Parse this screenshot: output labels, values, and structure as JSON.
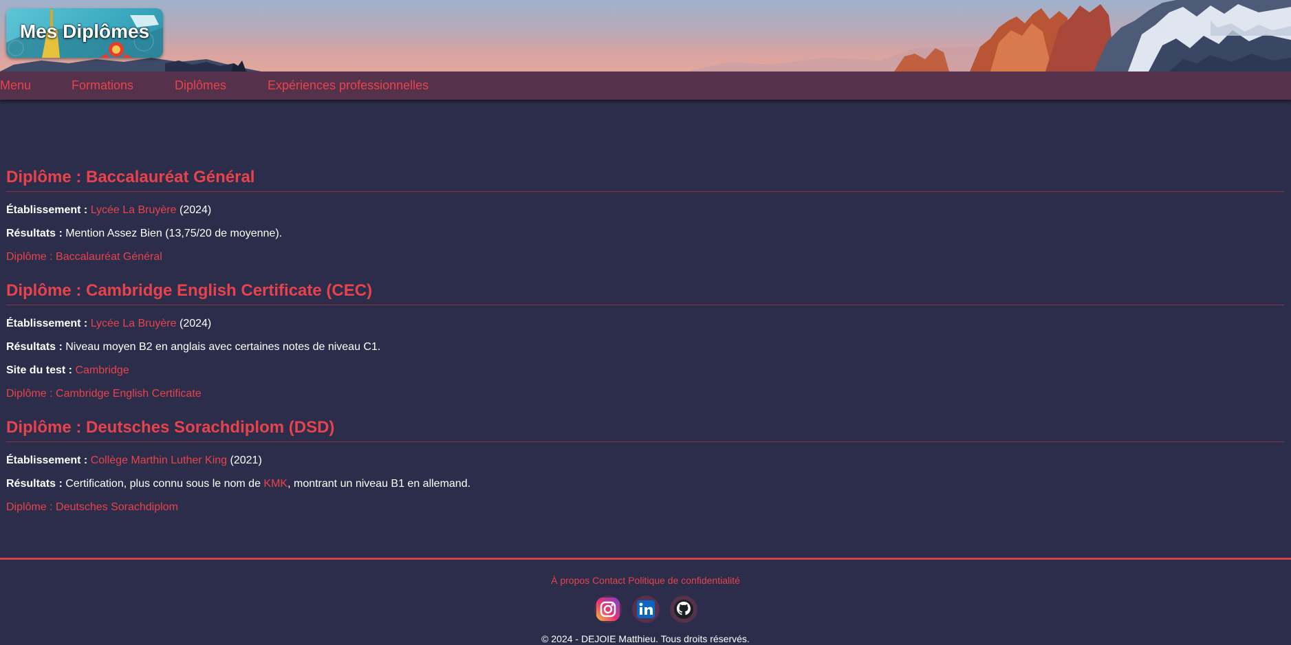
{
  "header": {
    "logo_title": "Mes Diplômes"
  },
  "nav": {
    "items": [
      {
        "label": "Menu"
      },
      {
        "label": "Formations"
      },
      {
        "label": "Diplômes"
      },
      {
        "label": "Expériences professionnelles"
      }
    ]
  },
  "labels": {
    "etablissement": "Établissement :",
    "resultats": "Résultats :",
    "site_test": "Site du test :"
  },
  "diplomas": [
    {
      "title": "Diplôme : Baccalauréat Général",
      "school": "Lycée La Bruyère",
      "year": "(2024)",
      "results": "Mention Assez Bien (13,75/20 de moyenne).",
      "diploma_link": "Diplôme : Baccalauréat Général"
    },
    {
      "title": "Diplôme : Cambridge English Certificate (CEC)",
      "school": "Lycée La Bruyère",
      "year": "(2024)",
      "results": "Niveau moyen B2 en anglais avec certaines notes de niveau C1.",
      "test_site": "Cambridge",
      "diploma_link": "Diplôme : Cambridge English Certificate"
    },
    {
      "title": "Diplôme : Deutsches Sorachdiplom (DSD)",
      "school": "Collège Marthin Luther King",
      "year": "(2021)",
      "results_before": "Certification, plus connu sous le nom de",
      "results_link": "KMK",
      "results_after": ", montrant un niveau B1 en allemand.",
      "diploma_link": "Diplôme : Deutsches Sorachdiplom"
    }
  ],
  "footer": {
    "links": [
      {
        "label": "À propos"
      },
      {
        "label": "Contact"
      },
      {
        "label": "Politique de confidentialité"
      }
    ],
    "copyright": "© 2024 - DEJOIE Matthieu. Tous droits réservés."
  },
  "colors": {
    "accent": "#e8434c",
    "background": "#2b2d4a",
    "navbar": "#55314b"
  },
  "icons": [
    "instagram-icon",
    "linkedin-icon",
    "github-icon"
  ]
}
